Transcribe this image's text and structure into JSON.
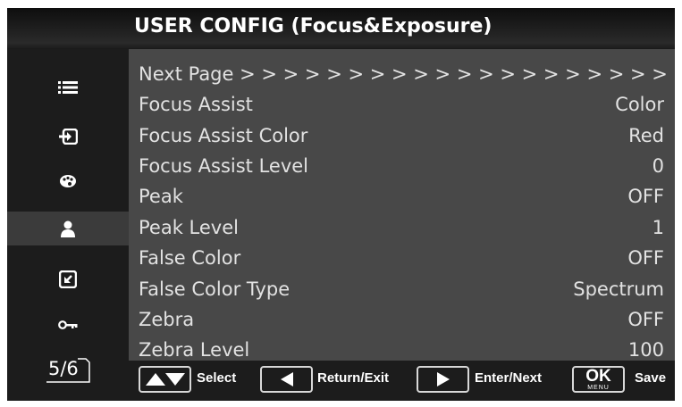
{
  "header": {
    "title": "USER CONFIG (Focus&Exposure)"
  },
  "sidebar": {
    "icons": [
      "list-icon",
      "input-icon",
      "palette-icon",
      "user-icon",
      "image-icon",
      "key-icon"
    ],
    "active_index": 3,
    "page_indicator": "5/6"
  },
  "menu": {
    "next_page": "Next Page > > > > > > > > > > > > > > > > > > > > > > > > >",
    "items": [
      {
        "label": "Focus Assist",
        "value": "Color"
      },
      {
        "label": "Focus Assist Color",
        "value": "Red"
      },
      {
        "label": "Focus Assist Level",
        "value": "0"
      },
      {
        "label": "Peak",
        "value": "OFF"
      },
      {
        "label": "Peak Level",
        "value": "1"
      },
      {
        "label": "False Color",
        "value": "OFF"
      },
      {
        "label": "False Color Type",
        "value": "Spectrum"
      },
      {
        "label": "Zebra",
        "value": "OFF"
      },
      {
        "label": "Zebra Level",
        "value": "100"
      }
    ]
  },
  "footer": {
    "select_label": "Select",
    "return_label": "Return/Exit",
    "enter_label": "Enter/Next",
    "ok_key": "OK",
    "menu_key": "MENU",
    "save_label": "Save"
  },
  "colors": {
    "screen_bg": "#1c1c1c",
    "menu_bg": "#484848",
    "active_bg": "#3b3b3b",
    "text": "#e2e2e2"
  }
}
